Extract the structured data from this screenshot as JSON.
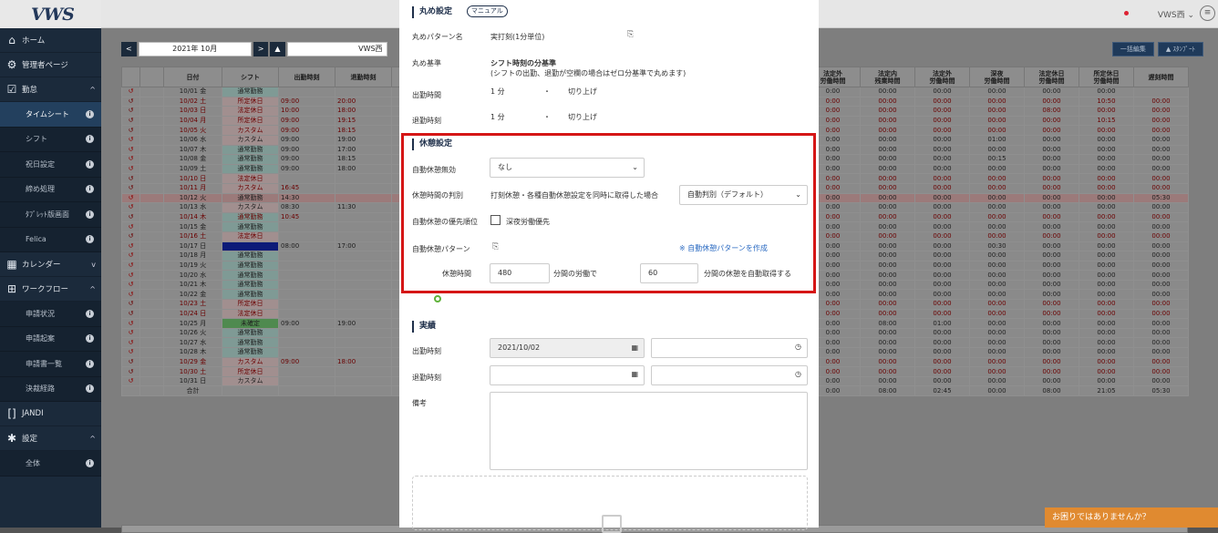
{
  "app": {
    "logo": "VWS",
    "user": "VWS西",
    "help": "お困りではありませんか？"
  },
  "sidebar": [
    {
      "type": "item",
      "icon": "home-icon",
      "glyph": "⌂",
      "label": "ホーム",
      "tail": ""
    },
    {
      "type": "item",
      "icon": "admin-icon",
      "glyph": "⚙",
      "label": "管理者ページ",
      "tail": ""
    },
    {
      "type": "item",
      "icon": "calendar-check-icon",
      "glyph": "☑",
      "label": "勤怠",
      "tail": "^"
    },
    {
      "type": "sub",
      "label": "タイムシート",
      "active": true
    },
    {
      "type": "sub",
      "label": "シフト"
    },
    {
      "type": "sub",
      "label": "祝日設定"
    },
    {
      "type": "sub",
      "label": "締め処理"
    },
    {
      "type": "sub",
      "label": "ﾀﾌﾞﾚｯﾄ版画面"
    },
    {
      "type": "sub",
      "label": "Felica"
    },
    {
      "type": "item",
      "icon": "calendar-icon",
      "glyph": "▦",
      "label": "カレンダー",
      "tail": "v"
    },
    {
      "type": "item",
      "icon": "workflow-icon",
      "glyph": "⊞",
      "label": "ワークフロー",
      "tail": "^"
    },
    {
      "type": "sub",
      "label": "申請状況"
    },
    {
      "type": "sub",
      "label": "申請起案"
    },
    {
      "type": "sub",
      "label": "申請書一覧"
    },
    {
      "type": "sub",
      "label": "決裁経路"
    },
    {
      "type": "item",
      "icon": "jandi-icon",
      "glyph": "[]",
      "label": "JANDI",
      "tail": ""
    },
    {
      "type": "item",
      "icon": "settings-icon",
      "glyph": "✱",
      "label": "設定",
      "tail": "^"
    },
    {
      "type": "sub",
      "label": "全体"
    }
  ],
  "toolbar": {
    "prev": "<",
    "month": "2021年 10月",
    "next": ">",
    "user_icon": "▲",
    "user": "VWS西",
    "bulk_edit": "一括編集",
    "export": "▲ ｽﾀﾝﾌﾟｰﾄ"
  },
  "table": {
    "headers": [
      "",
      "",
      "日付",
      "シフト",
      "出勤時刻",
      "退勤時刻",
      "",
      "法定外\n労働時間",
      "法定内\n残業時間",
      "法定外\n労働時間",
      "深夜\n労働時間",
      "法定休日\n労働時間",
      "所定休日\n労働時間",
      "遅刻時間"
    ],
    "rows": [
      {
        "date": "10/01 金",
        "shift": "通常勤務",
        "in": "",
        "out": "",
        "cols": [
          "0:00",
          "00:00",
          "00:00",
          "00:00",
          "00:00",
          "00:00",
          ""
        ],
        "red": false,
        "kind": "sh"
      },
      {
        "date": "10/02 土",
        "shift": "所定休日",
        "in": "09:00",
        "out": "20:00",
        "cols": [
          "0:00",
          "00:00",
          "00:00",
          "00:00",
          "00:00",
          "10:50",
          "00:00"
        ],
        "red": true,
        "kind": "shr"
      },
      {
        "date": "10/03 日",
        "shift": "法定休日",
        "in": "10:00",
        "out": "18:00",
        "cols": [
          "0:00",
          "00:00",
          "00:00",
          "00:00",
          "08:00",
          "00:00",
          "00:00"
        ],
        "red": true,
        "kind": "shr"
      },
      {
        "date": "10/04 月",
        "shift": "所定休日",
        "in": "09:00",
        "out": "19:15",
        "cols": [
          "0:00",
          "00:00",
          "00:00",
          "00:00",
          "00:00",
          "10:15",
          "00:00"
        ],
        "red": true,
        "kind": "shr"
      },
      {
        "date": "10/05 火",
        "shift": "カスタム",
        "in": "09:00",
        "out": "18:15",
        "cols": [
          "0:00",
          "00:00",
          "00:00",
          "00:00",
          "00:00",
          "00:00",
          "00:00"
        ],
        "red": true,
        "kind": "shr"
      },
      {
        "date": "10/06 水",
        "shift": "カスタム",
        "in": "09:00",
        "out": "19:00",
        "cols": [
          "0:00",
          "00:00",
          "00:00",
          "01:00",
          "00:00",
          "00:00",
          "00:00"
        ],
        "red": false,
        "kind": "shr"
      },
      {
        "date": "10/07 木",
        "shift": "通常勤務",
        "in": "09:00",
        "out": "17:00",
        "cols": [
          "0:00",
          "00:00",
          "00:00",
          "00:00",
          "00:00",
          "00:00",
          "00:00"
        ],
        "red": false,
        "kind": "sh"
      },
      {
        "date": "10/08 金",
        "shift": "通常勤務",
        "in": "09:00",
        "out": "18:15",
        "cols": [
          "0:00",
          "00:00",
          "00:00",
          "00:15",
          "00:00",
          "00:00",
          "00:00"
        ],
        "red": false,
        "kind": "sh"
      },
      {
        "date": "10/09 土",
        "shift": "通常勤務",
        "in": "09:00",
        "out": "18:00",
        "cols": [
          "0:00",
          "00:00",
          "00:00",
          "00:00",
          "00:00",
          "00:00",
          "00:00"
        ],
        "red": false,
        "kind": "sh"
      },
      {
        "date": "10/10 日",
        "shift": "法定休日",
        "in": "",
        "out": "",
        "cols": [
          "0:00",
          "00:00",
          "00:00",
          "00:00",
          "00:00",
          "00:00",
          "00:00"
        ],
        "red": true,
        "kind": "shr"
      },
      {
        "date": "10/11 月",
        "shift": "カスタム",
        "in": "16:45",
        "out": "",
        "cols": [
          "0:00",
          "00:00",
          "00:00",
          "00:00",
          "00:00",
          "00:00",
          "00:00"
        ],
        "red": true,
        "kind": "shr"
      },
      {
        "date": "10/12 火",
        "shift": "通常勤務",
        "in": "14:30",
        "out": "",
        "cols": [
          "0:00",
          "00:00",
          "00:00",
          "00:00",
          "00:00",
          "00:00",
          "05:30"
        ],
        "red": false,
        "kind": "sh",
        "hl": true
      },
      {
        "date": "10/13 水",
        "shift": "カスタム",
        "in": "08:30",
        "out": "11:30",
        "cols": [
          "0:00",
          "00:00",
          "00:00",
          "00:00",
          "00:00",
          "00:00",
          "00:00"
        ],
        "red": false,
        "kind": "shr"
      },
      {
        "date": "10/14 木",
        "shift": "通常勤務",
        "in": "10:45",
        "out": "",
        "cols": [
          "0:00",
          "00:00",
          "00:00",
          "00:00",
          "00:00",
          "00:00",
          "00:00"
        ],
        "red": true,
        "kind": "sh"
      },
      {
        "date": "10/15 金",
        "shift": "通常勤務",
        "in": "",
        "out": "",
        "cols": [
          "0:00",
          "00:00",
          "00:00",
          "00:00",
          "00:00",
          "00:00",
          "00:00"
        ],
        "red": false,
        "kind": "sh"
      },
      {
        "date": "10/16 土",
        "shift": "法定休日",
        "in": "",
        "out": "",
        "cols": [
          "0:00",
          "00:00",
          "00:00",
          "00:00",
          "00:00",
          "00:00",
          "00:00"
        ],
        "red": true,
        "kind": "shr"
      },
      {
        "date": "10/17 日",
        "shift": "",
        "in": "08:00",
        "out": "17:00",
        "cols": [
          "0:00",
          "00:00",
          "00:00",
          "00:30",
          "00:00",
          "00:00",
          "00:00"
        ],
        "red": false,
        "kind": "shb"
      },
      {
        "date": "10/18 月",
        "shift": "通常勤務",
        "in": "",
        "out": "",
        "cols": [
          "0:00",
          "00:00",
          "00:00",
          "00:00",
          "00:00",
          "00:00",
          "00:00"
        ],
        "red": false,
        "kind": "sh"
      },
      {
        "date": "10/19 火",
        "shift": "通常勤務",
        "in": "",
        "out": "",
        "cols": [
          "0:00",
          "00:00",
          "00:00",
          "00:00",
          "00:00",
          "00:00",
          "00:00"
        ],
        "red": false,
        "kind": "sh"
      },
      {
        "date": "10/20 水",
        "shift": "通常勤務",
        "in": "",
        "out": "",
        "cols": [
          "0:00",
          "00:00",
          "00:00",
          "00:00",
          "00:00",
          "00:00",
          "00:00"
        ],
        "red": false,
        "kind": "sh"
      },
      {
        "date": "10/21 木",
        "shift": "通常勤務",
        "in": "",
        "out": "",
        "cols": [
          "0:00",
          "00:00",
          "00:00",
          "00:00",
          "00:00",
          "00:00",
          "00:00"
        ],
        "red": false,
        "kind": "sh"
      },
      {
        "date": "10/22 金",
        "shift": "通常勤務",
        "in": "",
        "out": "",
        "cols": [
          "0:00",
          "00:00",
          "00:00",
          "00:00",
          "00:00",
          "00:00",
          "00:00"
        ],
        "red": false,
        "kind": "sh"
      },
      {
        "date": "10/23 土",
        "shift": "所定休日",
        "in": "",
        "out": "",
        "cols": [
          "0:00",
          "00:00",
          "00:00",
          "00:00",
          "00:00",
          "00:00",
          "00:00"
        ],
        "red": true,
        "kind": "shr"
      },
      {
        "date": "10/24 日",
        "shift": "法定休日",
        "in": "",
        "out": "",
        "cols": [
          "0:00",
          "00:00",
          "00:00",
          "00:00",
          "00:00",
          "00:00",
          "00:00"
        ],
        "red": true,
        "kind": "shr"
      },
      {
        "date": "10/25 月",
        "shift": "未確定",
        "in": "09:00",
        "out": "19:00",
        "cols": [
          "0:00",
          "08:00",
          "01:00",
          "00:00",
          "00:00",
          "00:00",
          "00:00"
        ],
        "red": false,
        "kind": "shg"
      },
      {
        "date": "10/26 火",
        "shift": "通常勤務",
        "in": "",
        "out": "",
        "cols": [
          "0:00",
          "00:00",
          "00:00",
          "00:00",
          "00:00",
          "00:00",
          "00:00"
        ],
        "red": false,
        "kind": "sh"
      },
      {
        "date": "10/27 水",
        "shift": "通常勤務",
        "in": "",
        "out": "",
        "cols": [
          "0:00",
          "00:00",
          "00:00",
          "00:00",
          "00:00",
          "00:00",
          "00:00"
        ],
        "red": false,
        "kind": "sh"
      },
      {
        "date": "10/28 木",
        "shift": "通常勤務",
        "in": "",
        "out": "",
        "cols": [
          "0:00",
          "00:00",
          "00:00",
          "00:00",
          "00:00",
          "00:00",
          "00:00"
        ],
        "red": false,
        "kind": "sh"
      },
      {
        "date": "10/29 金",
        "shift": "カスタム",
        "in": "09:00",
        "out": "18:00",
        "cols": [
          "0:00",
          "00:00",
          "00:00",
          "00:00",
          "00:00",
          "00:00",
          "00:00"
        ],
        "red": true,
        "kind": "shr"
      },
      {
        "date": "10/30 土",
        "shift": "所定休日",
        "in": "",
        "out": "",
        "cols": [
          "0:00",
          "00:00",
          "00:00",
          "00:00",
          "00:00",
          "00:00",
          "00:00"
        ],
        "red": true,
        "kind": "shr"
      },
      {
        "date": "10/31 日",
        "shift": "カスタム",
        "in": "",
        "out": "",
        "cols": [
          "0:00",
          "00:00",
          "00:00",
          "00:00",
          "00:00",
          "00:00",
          "00:00"
        ],
        "red": false,
        "kind": "shr"
      },
      {
        "date": "合計",
        "shift": "",
        "in": "",
        "out": "",
        "cols": [
          "0:00",
          "08:00",
          "02:45",
          "00:00",
          "08:00",
          "21:05",
          "05:30"
        ],
        "red": false,
        "kind": "",
        "total": true
      }
    ]
  },
  "modal": {
    "rounding": {
      "title": "丸め設定",
      "manual": "マニュアル",
      "pattern_label": "丸めパターン名",
      "pattern_value": "実打刻(1分単位)",
      "basis_label": "丸め基準",
      "basis_bold": "シフト時刻の分基準",
      "basis_note": "(シフトの出勤、退勤が空欄の場合はゼロ分基準で丸めます)",
      "in_label": "出勤時間",
      "in_unit": "1 分",
      "in_mode": "切り上げ",
      "out_label": "退勤時刻",
      "out_unit": "1 分",
      "out_mode": "切り上げ"
    },
    "break": {
      "title": "休憩設定",
      "disable_label": "自動休憩無効",
      "disable_value": "なし",
      "judge_label": "休憩時間の判別",
      "judge_text": "打刻休憩・各種自動休憩設定を同時に取得した場合",
      "judge_value": "自動判別（デフォルト）",
      "priority_label": "自動休憩の優先順位",
      "priority_check": "深夜労働優先",
      "pattern_label": "自動休憩パターン",
      "pattern_link": "※ 自動休憩パターンを作成",
      "time_label": "休憩時間",
      "work_min": "480",
      "work_text": "分間の労働で",
      "break_min": "60",
      "break_text": "分間の休憩を自動取得する"
    },
    "actual": {
      "title": "実績",
      "in_label": "出勤時刻",
      "in_date": "2021/10/02",
      "out_label": "退勤時刻",
      "note_label": "備考"
    }
  }
}
